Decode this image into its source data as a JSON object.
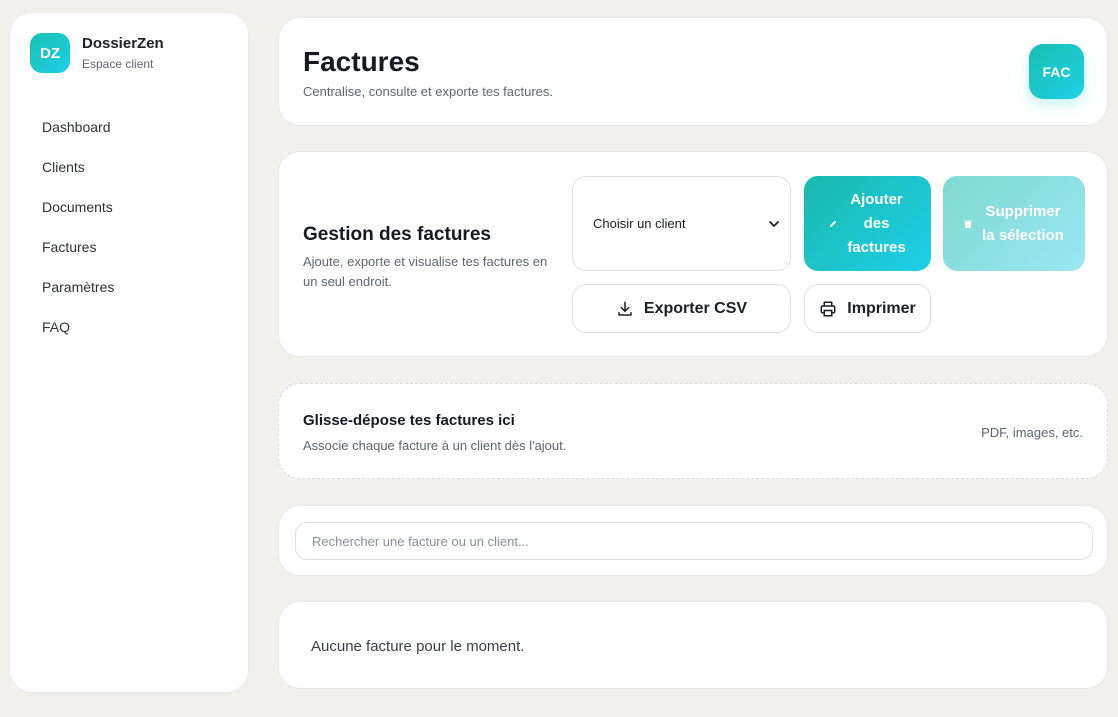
{
  "brand": {
    "logo": "DZ",
    "name": "DossierZen",
    "subtitle": "Espace client"
  },
  "sidebar": {
    "items": [
      {
        "label": "Dashboard"
      },
      {
        "label": "Clients"
      },
      {
        "label": "Documents"
      },
      {
        "label": "Factures"
      },
      {
        "label": "Paramètres"
      },
      {
        "label": "FAQ"
      }
    ]
  },
  "header": {
    "title": "Factures",
    "subtitle": "Centralise, consulte et exporte tes factures.",
    "badge": "FAC"
  },
  "manage": {
    "title": "Gestion des factures",
    "description": "Ajoute, exporte et visualise tes factures en un seul endroit.",
    "client_select": {
      "selected": "Choisir un client"
    },
    "add_label": "Ajouter des factures",
    "delete_label": "Supprimer la sélection",
    "export_label": "Exporter CSV",
    "print_label": "Imprimer"
  },
  "dropzone": {
    "title": "Glisse-dépose tes factures ici",
    "description": "Associe chaque facture à un client dès l'ajout.",
    "hint": "PDF, images, etc."
  },
  "search": {
    "placeholder": "Rechercher une facture ou un client..."
  },
  "list": {
    "empty_message": "Aucune facture pour le moment."
  },
  "colors": {
    "accent_start": "#18bfb0",
    "accent_end": "#1fd0e6",
    "background": "#f1f0ed"
  }
}
